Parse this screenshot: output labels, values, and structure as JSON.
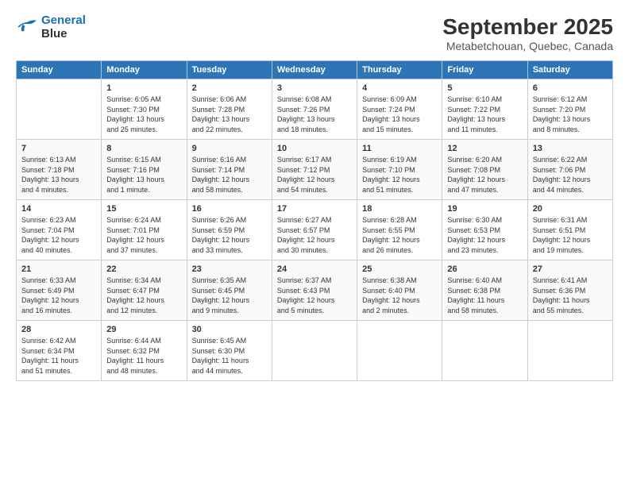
{
  "logo": {
    "line1": "General",
    "line2": "Blue"
  },
  "title": "September 2025",
  "subtitle": "Metabetchouan, Quebec, Canada",
  "days_of_week": [
    "Sunday",
    "Monday",
    "Tuesday",
    "Wednesday",
    "Thursday",
    "Friday",
    "Saturday"
  ],
  "weeks": [
    [
      {
        "day": "",
        "info": ""
      },
      {
        "day": "1",
        "info": "Sunrise: 6:05 AM\nSunset: 7:30 PM\nDaylight: 13 hours\nand 25 minutes."
      },
      {
        "day": "2",
        "info": "Sunrise: 6:06 AM\nSunset: 7:28 PM\nDaylight: 13 hours\nand 22 minutes."
      },
      {
        "day": "3",
        "info": "Sunrise: 6:08 AM\nSunset: 7:26 PM\nDaylight: 13 hours\nand 18 minutes."
      },
      {
        "day": "4",
        "info": "Sunrise: 6:09 AM\nSunset: 7:24 PM\nDaylight: 13 hours\nand 15 minutes."
      },
      {
        "day": "5",
        "info": "Sunrise: 6:10 AM\nSunset: 7:22 PM\nDaylight: 13 hours\nand 11 minutes."
      },
      {
        "day": "6",
        "info": "Sunrise: 6:12 AM\nSunset: 7:20 PM\nDaylight: 13 hours\nand 8 minutes."
      }
    ],
    [
      {
        "day": "7",
        "info": "Sunrise: 6:13 AM\nSunset: 7:18 PM\nDaylight: 13 hours\nand 4 minutes."
      },
      {
        "day": "8",
        "info": "Sunrise: 6:15 AM\nSunset: 7:16 PM\nDaylight: 13 hours\nand 1 minute."
      },
      {
        "day": "9",
        "info": "Sunrise: 6:16 AM\nSunset: 7:14 PM\nDaylight: 12 hours\nand 58 minutes."
      },
      {
        "day": "10",
        "info": "Sunrise: 6:17 AM\nSunset: 7:12 PM\nDaylight: 12 hours\nand 54 minutes."
      },
      {
        "day": "11",
        "info": "Sunrise: 6:19 AM\nSunset: 7:10 PM\nDaylight: 12 hours\nand 51 minutes."
      },
      {
        "day": "12",
        "info": "Sunrise: 6:20 AM\nSunset: 7:08 PM\nDaylight: 12 hours\nand 47 minutes."
      },
      {
        "day": "13",
        "info": "Sunrise: 6:22 AM\nSunset: 7:06 PM\nDaylight: 12 hours\nand 44 minutes."
      }
    ],
    [
      {
        "day": "14",
        "info": "Sunrise: 6:23 AM\nSunset: 7:04 PM\nDaylight: 12 hours\nand 40 minutes."
      },
      {
        "day": "15",
        "info": "Sunrise: 6:24 AM\nSunset: 7:01 PM\nDaylight: 12 hours\nand 37 minutes."
      },
      {
        "day": "16",
        "info": "Sunrise: 6:26 AM\nSunset: 6:59 PM\nDaylight: 12 hours\nand 33 minutes."
      },
      {
        "day": "17",
        "info": "Sunrise: 6:27 AM\nSunset: 6:57 PM\nDaylight: 12 hours\nand 30 minutes."
      },
      {
        "day": "18",
        "info": "Sunrise: 6:28 AM\nSunset: 6:55 PM\nDaylight: 12 hours\nand 26 minutes."
      },
      {
        "day": "19",
        "info": "Sunrise: 6:30 AM\nSunset: 6:53 PM\nDaylight: 12 hours\nand 23 minutes."
      },
      {
        "day": "20",
        "info": "Sunrise: 6:31 AM\nSunset: 6:51 PM\nDaylight: 12 hours\nand 19 minutes."
      }
    ],
    [
      {
        "day": "21",
        "info": "Sunrise: 6:33 AM\nSunset: 6:49 PM\nDaylight: 12 hours\nand 16 minutes."
      },
      {
        "day": "22",
        "info": "Sunrise: 6:34 AM\nSunset: 6:47 PM\nDaylight: 12 hours\nand 12 minutes."
      },
      {
        "day": "23",
        "info": "Sunrise: 6:35 AM\nSunset: 6:45 PM\nDaylight: 12 hours\nand 9 minutes."
      },
      {
        "day": "24",
        "info": "Sunrise: 6:37 AM\nSunset: 6:43 PM\nDaylight: 12 hours\nand 5 minutes."
      },
      {
        "day": "25",
        "info": "Sunrise: 6:38 AM\nSunset: 6:40 PM\nDaylight: 12 hours\nand 2 minutes."
      },
      {
        "day": "26",
        "info": "Sunrise: 6:40 AM\nSunset: 6:38 PM\nDaylight: 11 hours\nand 58 minutes."
      },
      {
        "day": "27",
        "info": "Sunrise: 6:41 AM\nSunset: 6:36 PM\nDaylight: 11 hours\nand 55 minutes."
      }
    ],
    [
      {
        "day": "28",
        "info": "Sunrise: 6:42 AM\nSunset: 6:34 PM\nDaylight: 11 hours\nand 51 minutes."
      },
      {
        "day": "29",
        "info": "Sunrise: 6:44 AM\nSunset: 6:32 PM\nDaylight: 11 hours\nand 48 minutes."
      },
      {
        "day": "30",
        "info": "Sunrise: 6:45 AM\nSunset: 6:30 PM\nDaylight: 11 hours\nand 44 minutes."
      },
      {
        "day": "",
        "info": ""
      },
      {
        "day": "",
        "info": ""
      },
      {
        "day": "",
        "info": ""
      },
      {
        "day": "",
        "info": ""
      }
    ]
  ]
}
